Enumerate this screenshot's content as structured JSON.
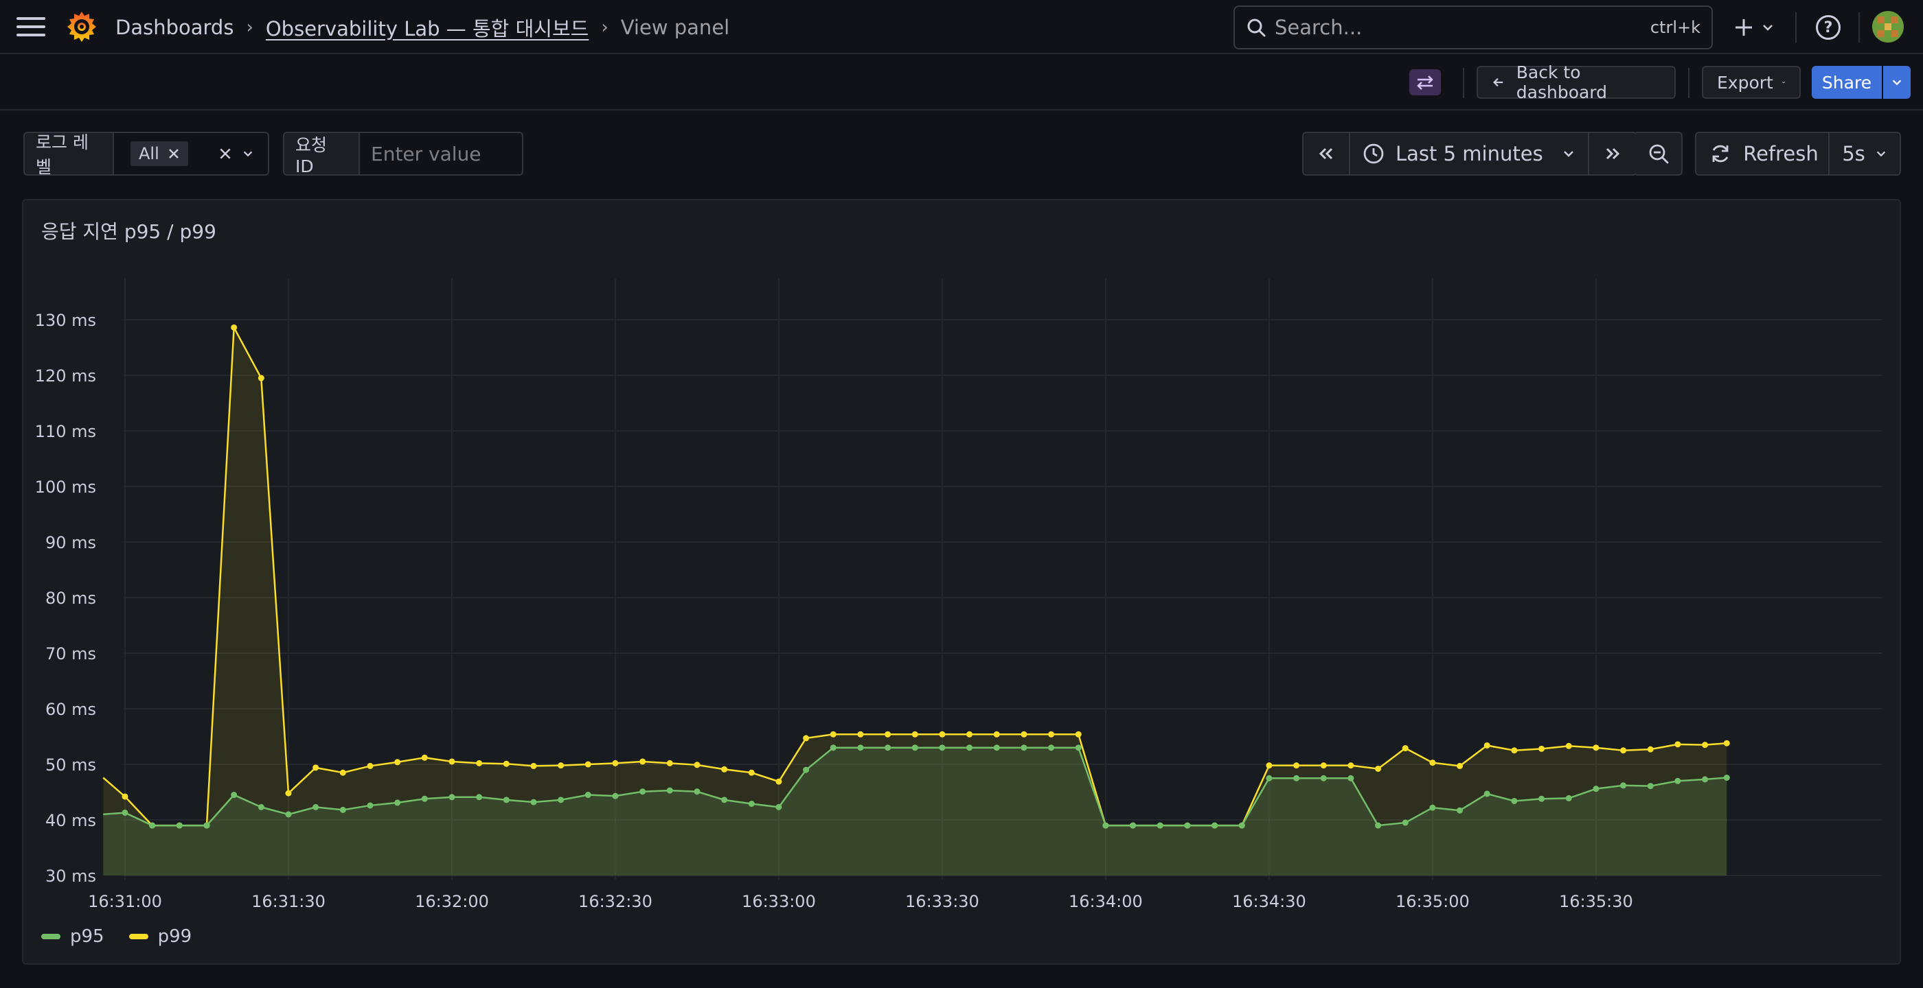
{
  "nav": {
    "breadcrumb": [
      "Dashboards",
      "Observability Lab — 통합 대시보드",
      "View panel"
    ],
    "search_placeholder": "Search...",
    "search_shortcut": "ctrl+k"
  },
  "toolbar": {
    "back_label": "Back to dashboard",
    "export_label": "Export",
    "share_label": "Share"
  },
  "variables": {
    "log_level_label": "로그 레벨",
    "log_level_value": "All",
    "request_id_label": "요청 ID",
    "request_id_placeholder": "Enter value"
  },
  "time_picker": {
    "range_label": "Last 5 minutes",
    "refresh_label": "Refresh",
    "refresh_interval": "5s"
  },
  "panel": {
    "title": "응답 지연 p95 / p99"
  },
  "colors": {
    "p95": "#73bf69",
    "p99": "#fade2a",
    "accent": "#3d71d9"
  },
  "chart_data": {
    "type": "line",
    "title": "응답 지연 p95 / p99",
    "y_unit": "ms",
    "ylim": [
      30,
      130
    ],
    "y_ticks": [
      "30 ms",
      "40 ms",
      "50 ms",
      "60 ms",
      "70 ms",
      "80 ms",
      "90 ms",
      "100 ms",
      "110 ms",
      "120 ms",
      "130 ms"
    ],
    "x_ticks": [
      "16:31:00",
      "16:31:30",
      "16:32:00",
      "16:32:30",
      "16:33:00",
      "16:33:30",
      "16:34:00",
      "16:34:30",
      "16:35:00",
      "16:35:30"
    ],
    "x_range": [
      "16:30:56",
      "16:35:54"
    ],
    "grid": true,
    "legend_placement": "bottom-left",
    "x": [
      "16:30:56",
      "16:31:00",
      "16:31:05",
      "16:31:10",
      "16:31:15",
      "16:31:20",
      "16:31:25",
      "16:31:30",
      "16:31:35",
      "16:31:40",
      "16:31:45",
      "16:31:50",
      "16:31:55",
      "16:32:00",
      "16:32:05",
      "16:32:10",
      "16:32:15",
      "16:32:20",
      "16:32:25",
      "16:32:30",
      "16:32:35",
      "16:32:40",
      "16:32:45",
      "16:32:50",
      "16:32:55",
      "16:33:00",
      "16:33:05",
      "16:33:10",
      "16:33:15",
      "16:33:20",
      "16:33:25",
      "16:33:30",
      "16:33:35",
      "16:33:40",
      "16:33:45",
      "16:33:50",
      "16:33:55",
      "16:34:00",
      "16:34:05",
      "16:34:10",
      "16:34:15",
      "16:34:20",
      "16:34:25",
      "16:34:30",
      "16:34:35",
      "16:34:40",
      "16:34:45",
      "16:34:50",
      "16:34:55",
      "16:35:00",
      "16:35:05",
      "16:35:10",
      "16:35:15",
      "16:35:20",
      "16:35:25",
      "16:35:30",
      "16:35:35",
      "16:35:40",
      "16:35:45",
      "16:35:50",
      "16:35:54"
    ],
    "series": [
      {
        "name": "p95",
        "values": [
          41,
          41.3,
          39,
          39,
          39,
          44.5,
          42.3,
          41,
          42.3,
          41.8,
          42.6,
          43.1,
          43.8,
          44.1,
          44.1,
          43.6,
          43.2,
          43.6,
          44.5,
          44.3,
          45.1,
          45.3,
          45.1,
          43.6,
          42.9,
          42.3,
          49,
          53,
          53,
          53,
          53,
          53,
          53,
          53,
          53,
          53,
          53,
          39,
          39,
          39,
          39,
          39,
          39,
          47.5,
          47.5,
          47.5,
          47.5,
          39,
          39.5,
          42.2,
          41.7,
          44.7,
          43.4,
          43.8,
          43.9,
          45.6,
          46.2,
          46.1,
          47,
          47.3,
          47.6
        ]
      },
      {
        "name": "p99",
        "values": [
          47.6,
          44.2,
          39,
          39,
          39,
          128.6,
          119.5,
          44.8,
          49.4,
          48.5,
          49.7,
          50.4,
          51.2,
          50.5,
          50.2,
          50.1,
          49.7,
          49.8,
          50,
          50.2,
          50.5,
          50.2,
          49.9,
          49.1,
          48.5,
          46.9,
          54.7,
          55.4,
          55.4,
          55.4,
          55.4,
          55.4,
          55.4,
          55.4,
          55.4,
          55.4,
          55.4,
          39,
          39,
          39,
          39,
          39,
          39,
          49.8,
          49.8,
          49.8,
          49.8,
          49.2,
          52.9,
          50.3,
          49.7,
          53.4,
          52.5,
          52.8,
          53.3,
          53,
          52.5,
          52.7,
          53.6,
          53.5,
          53.8
        ]
      }
    ]
  }
}
